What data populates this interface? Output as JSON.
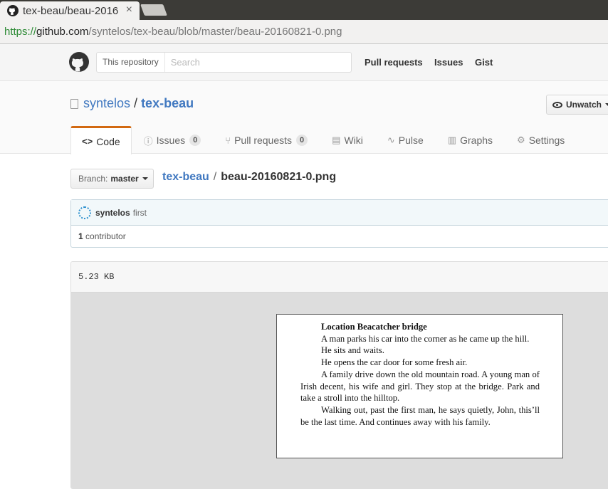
{
  "browser": {
    "tab_title": "tex-beau/beau-2016",
    "tab_close": "×",
    "url_scheme": "https://",
    "url_host": "github.com",
    "url_path": "/syntelos/tex-beau/blob/master/beau-20160821-0.png"
  },
  "header": {
    "search_scope": "This repository",
    "search_placeholder": "Search",
    "nav": [
      "Pull requests",
      "Issues",
      "Gist"
    ]
  },
  "repo": {
    "owner": "syntelos",
    "separator": "/",
    "name": "tex-beau",
    "unwatch_label": "Unwatch"
  },
  "tabs": [
    {
      "label": "Code",
      "icon": "<>"
    },
    {
      "label": "Issues",
      "count": "0",
      "icon": "ⓘ"
    },
    {
      "label": "Pull requests",
      "count": "0",
      "icon": "⑂"
    },
    {
      "label": "Wiki",
      "icon": "▤"
    },
    {
      "label": "Pulse",
      "icon": "∿"
    },
    {
      "label": "Graphs",
      "icon": "▥"
    },
    {
      "label": "Settings",
      "icon": "⚙"
    }
  ],
  "file_nav": {
    "branch_prefix": "Branch:",
    "branch_name": "master",
    "bc_repo": "tex-beau",
    "bc_sep": "/",
    "bc_file": "beau-20160821-0.png"
  },
  "commit": {
    "author": "syntelos",
    "message": "first",
    "contrib_count": "1",
    "contrib_label": "contributor"
  },
  "file": {
    "size": "5.23 KB"
  },
  "document": {
    "title": "Location Beacatcher bridge",
    "paragraphs": [
      "A man parks his car into the corner as he came up the hill.",
      "He sits and waits.",
      "He opens the car door for some fresh air.",
      "A family drive down the old mountain road. A young man of Irish decent, his wife and girl. They stop at the bridge. Park and take a stroll into the hilltop.",
      "Walking out, past the first man, he says quietly, John, this’ll be the last time. And continues away with his family."
    ]
  },
  "colors": {
    "link": "#4078c0",
    "active_tab_accent": "#d26911",
    "url_scheme": "#2e8b36"
  }
}
